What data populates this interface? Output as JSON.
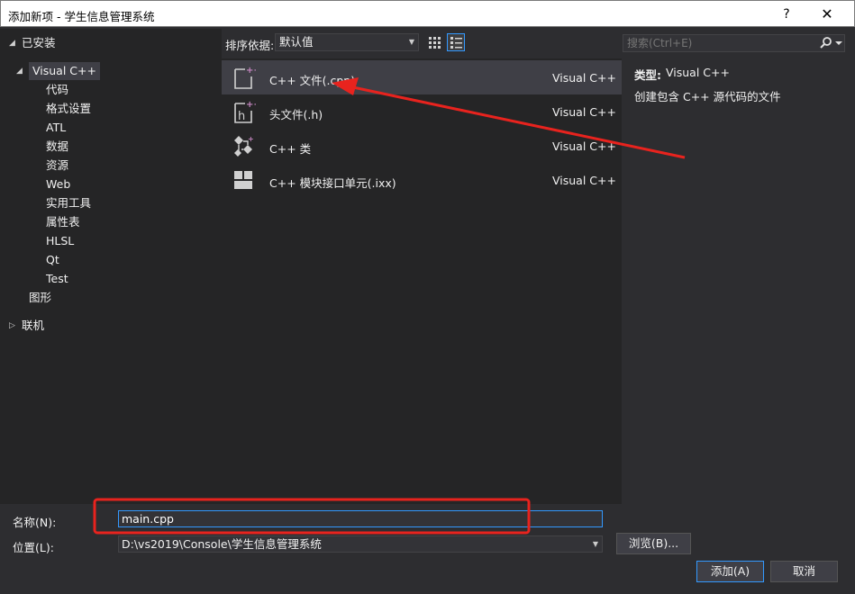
{
  "window": {
    "title": "添加新项 - 学生信息管理系统",
    "help_glyph": "?",
    "close_glyph": "✕"
  },
  "tree": {
    "installed": "已安装",
    "visual_cpp": "Visual C++",
    "children": [
      "代码",
      "格式设置",
      "ATL",
      "数据",
      "资源",
      "Web",
      "实用工具",
      "属性表",
      "HLSL",
      "Qt",
      "Test"
    ],
    "graphics": "图形",
    "online": "联机"
  },
  "toolbar": {
    "sort_label": "排序依据:",
    "sort_value": "默认值"
  },
  "search": {
    "placeholder": "搜索(Ctrl+E)"
  },
  "templates": [
    {
      "name": "C++ 文件(.cpp)",
      "lang": "Visual C++",
      "icon": "cpp-file-icon",
      "selected": true
    },
    {
      "name": "头文件(.h)",
      "lang": "Visual C++",
      "icon": "header-file-icon",
      "selected": false
    },
    {
      "name": "C++ 类",
      "lang": "Visual C++",
      "icon": "cpp-class-icon",
      "selected": false
    },
    {
      "name": "C++ 模块接口单元(.ixx)",
      "lang": "Visual C++",
      "icon": "module-interface-icon",
      "selected": false
    }
  ],
  "info": {
    "type_label": "类型:",
    "type_value": "Visual C++",
    "description": "创建包含 C++ 源代码的文件"
  },
  "form": {
    "name_label": "名称(N):",
    "name_value": "main.cpp",
    "location_label": "位置(L):",
    "location_value": "D:\\vs2019\\Console\\学生信息管理系统",
    "browse_label": "浏览(B)...",
    "add_label": "添加(A)",
    "cancel_label": "取消"
  },
  "colors": {
    "accent": "#3399ff",
    "annotation": "#e8231e",
    "template_icon": "#d0d0d0",
    "plus_badge": "#c586c0"
  }
}
